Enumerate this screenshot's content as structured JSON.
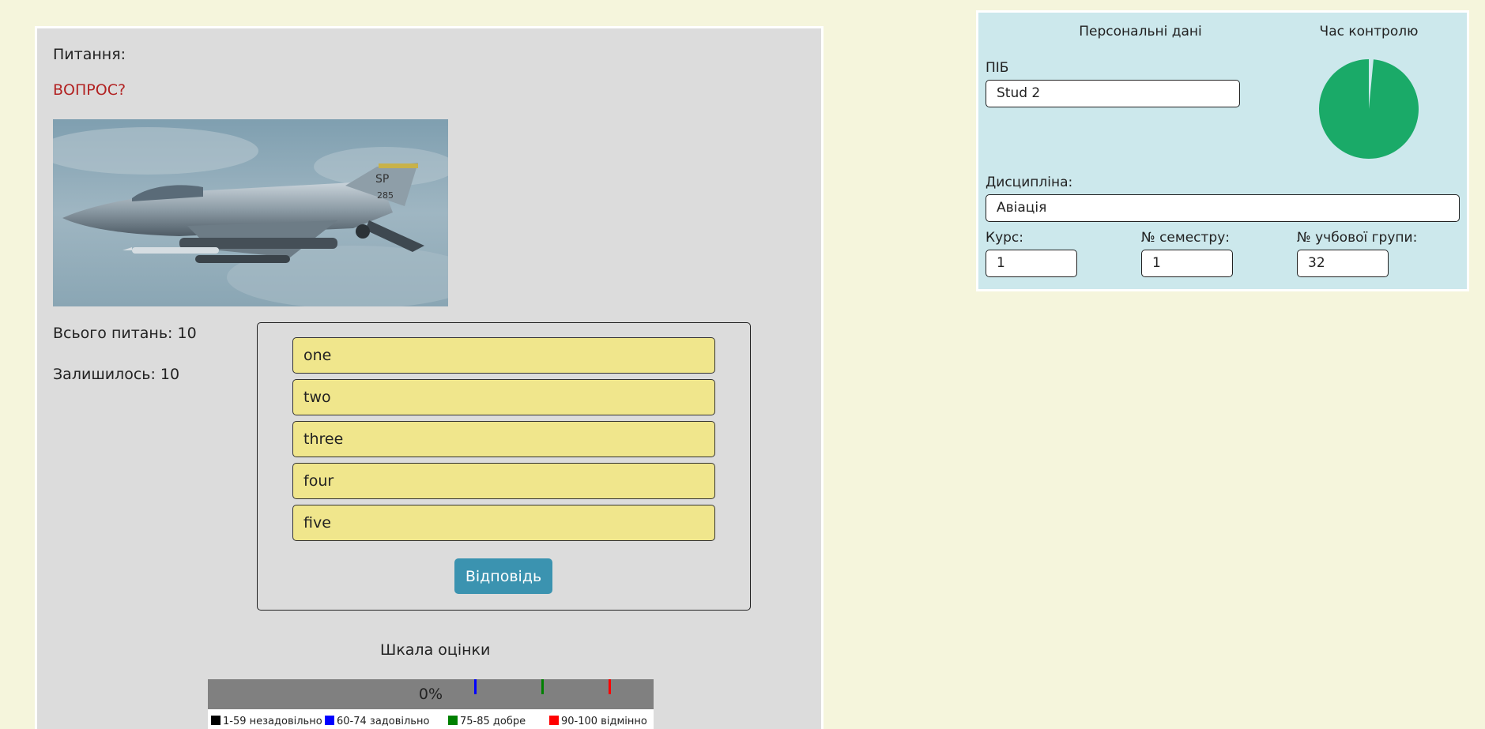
{
  "quiz": {
    "question_label": "Питання:",
    "question_text": "ВОПРОС?",
    "image_alt": "fighter-jet-photo",
    "total_label": "Всього питань: 10",
    "remaining_label": "Залишилось: 10",
    "answers": [
      "one",
      "two",
      "three",
      "four",
      "five"
    ],
    "submit_label": "Відповідь"
  },
  "scale": {
    "title": "Шкала оцінки",
    "percent_text": "0%",
    "progress": 0,
    "legend": [
      {
        "label": "1-59 незадовільно",
        "color": "#000000"
      },
      {
        "label": "60-74 задовільно",
        "color": "#0000ff"
      },
      {
        "label": "75-85 добре",
        "color": "#008000"
      },
      {
        "label": "90-100 відмінно",
        "color": "#ff0000"
      }
    ],
    "thresholds": [
      {
        "value": 60,
        "color": "#0000ff"
      },
      {
        "value": 75,
        "color": "#008000"
      },
      {
        "value": 90,
        "color": "#ff0000"
      }
    ]
  },
  "personal": {
    "heading": "Персональні дані",
    "timer_heading": "Час контролю",
    "name_label": "ПІБ",
    "name_value": "Stud 2",
    "discipline_label": "Дисципліна:",
    "discipline_value": "Авіація",
    "course_label": "Курс:",
    "course_value": "1",
    "semester_label": "№ семестру:",
    "semester_value": "1",
    "group_label": "№ учбової групи:",
    "group_value": "32"
  },
  "timer": {
    "remaining_fraction": 0.985,
    "color": "#1aaa68",
    "elapsed_color": "#cce8ec"
  },
  "colors": {
    "page_bg": "#f5f5dc",
    "quiz_panel_bg": "#dcdcdc",
    "info_panel_bg": "#cce8ec",
    "question_color": "#b22222",
    "answer_bg": "#f0e68c",
    "button_bg": "#3b93b0",
    "scale_bg": "#808080"
  }
}
